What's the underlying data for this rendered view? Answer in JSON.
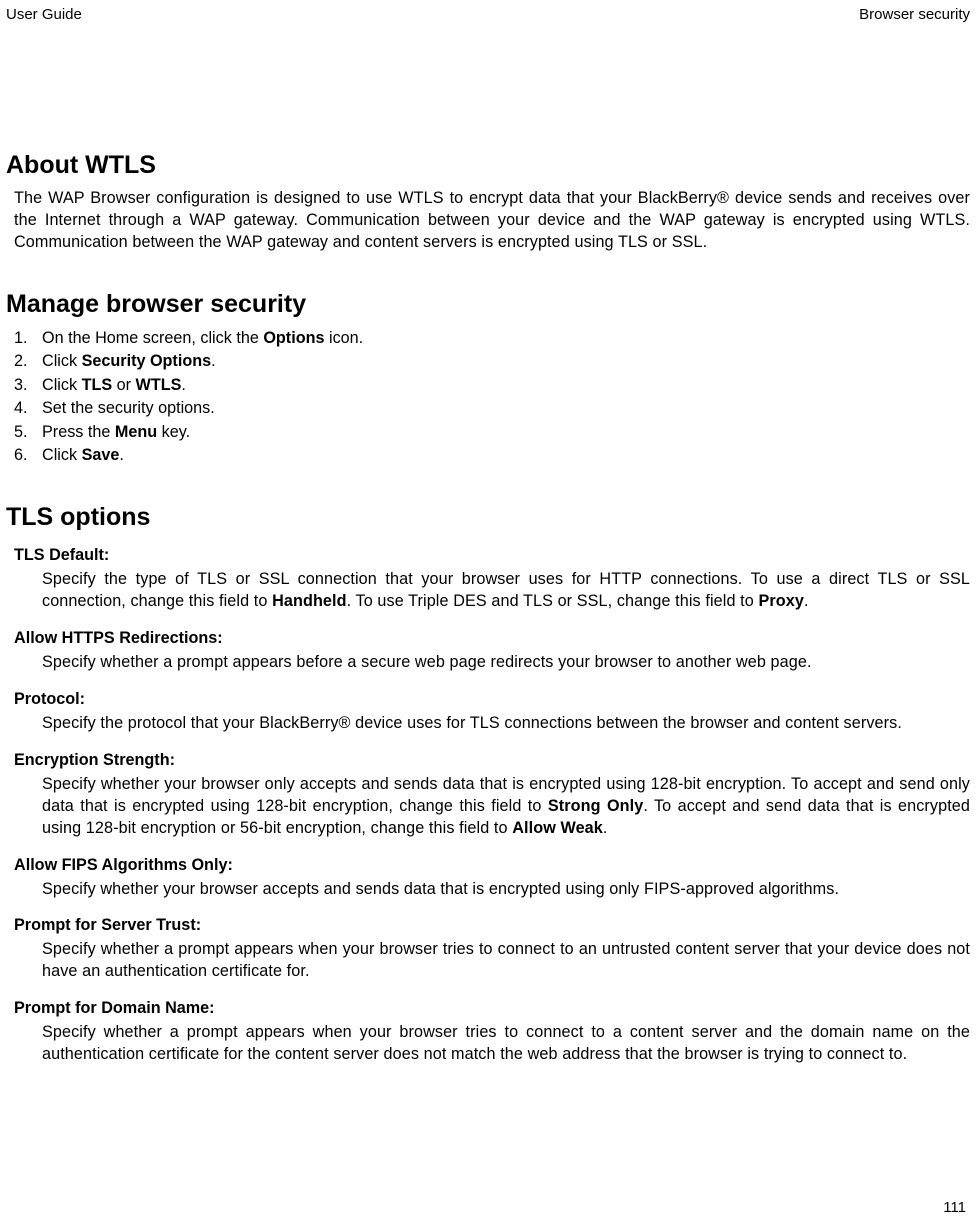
{
  "header": {
    "left": "User Guide",
    "right": "Browser security"
  },
  "sections": {
    "about": {
      "title": "About WTLS",
      "p1a": "The WAP Browser configuration is designed to use WTLS to encrypt data that your BlackBerry® device sends and receives over the Internet through a WAP gateway. Communication between your device and the WAP gateway is encrypted using WTLS. Communication between the WAP gateway and content servers is encrypted using TLS or SSL."
    },
    "manage": {
      "title": "Manage browser security",
      "steps": [
        {
          "n": "1.",
          "pre": "On the Home screen, click the ",
          "b1": "Options",
          "post": " icon."
        },
        {
          "n": "2.",
          "pre": "Click ",
          "b1": "Security Options",
          "post": "."
        },
        {
          "n": "3.",
          "pre": "Click ",
          "b1": "TLS",
          "mid": " or ",
          "b2": "WTLS",
          "post": "."
        },
        {
          "n": "4.",
          "pre": "Set the security options."
        },
        {
          "n": "5.",
          "pre": "Press the ",
          "b1": "Menu",
          "post": " key."
        },
        {
          "n": "6.",
          "pre": "Click ",
          "b1": "Save",
          "post": "."
        }
      ]
    },
    "tls": {
      "title": "TLS options",
      "defs": [
        {
          "term": "TLS Default:",
          "desc_pre": "Specify the type of TLS or SSL connection that your browser uses for HTTP connections. To use a direct TLS or SSL connection, change this field to ",
          "b1": "Handheld",
          "mid": ". To use Triple DES and TLS or SSL, change this field to ",
          "b2": "Proxy",
          "post": "."
        },
        {
          "term": "Allow HTTPS Redirections:",
          "desc_pre": "Specify whether a prompt appears before a secure web page redirects your browser to another web page."
        },
        {
          "term": "Protocol:",
          "desc_pre": "Specify the protocol that your BlackBerry® device uses for TLS connections between the browser and content servers."
        },
        {
          "term": "Encryption Strength:",
          "desc_pre": "Specify whether your browser only accepts and sends data that is encrypted using 128-bit encryption. To accept and send only data that is encrypted using 128-bit encryption, change this field to ",
          "b1": "Strong Only",
          "mid": ". To accept and send data that is encrypted using 128-bit encryption or 56-bit encryption, change this field to ",
          "b2": "Allow Weak",
          "post": "."
        },
        {
          "term": "Allow FIPS Algorithms Only:",
          "desc_pre": "Specify whether your browser accepts and sends data that is encrypted using only FIPS-approved algorithms."
        },
        {
          "term": "Prompt for Server Trust:",
          "desc_pre": "Specify whether a prompt appears when your browser tries to connect to an untrusted content server that your device does not have an authentication certificate for."
        },
        {
          "term": "Prompt for Domain Name:",
          "desc_pre": "Specify whether a prompt appears when your browser tries to connect to a content server and the domain name on the authentication certificate for the content server does not match the web address that the browser is trying to connect to."
        }
      ]
    }
  },
  "footer": {
    "page_number": "111"
  }
}
